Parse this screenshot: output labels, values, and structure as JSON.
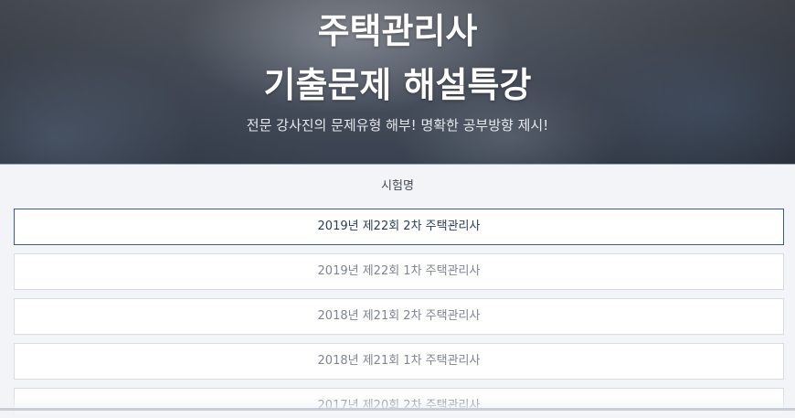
{
  "hero": {
    "title_line1": "주택관리사",
    "title_line2": "기출문제 해설특강",
    "subtitle": "전문 강사진의 문제유형 해부! 명확한 공부방향 제시!"
  },
  "exam_list": {
    "header": "시험명",
    "items": [
      {
        "label": "2019년 제22회 2차 주택관리사",
        "selected": true
      },
      {
        "label": "2019년 제22회 1차 주택관리사",
        "selected": false
      },
      {
        "label": "2018년 제21회 2차 주택관리사",
        "selected": false
      },
      {
        "label": "2018년 제21회 1차 주택관리사",
        "selected": false
      },
      {
        "label": "2017년 제20회 2차 주택관리사",
        "selected": false
      }
    ]
  },
  "colors": {
    "selected_border": "#3c5a8c",
    "page_background": "#f2f4f7"
  }
}
